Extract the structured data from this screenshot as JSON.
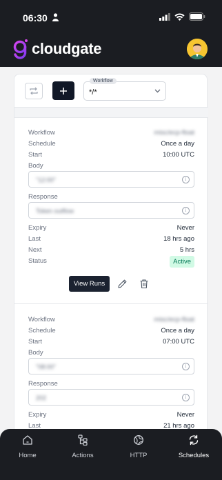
{
  "status_bar": {
    "time": "06:30"
  },
  "header": {
    "app_name": "cloudgate"
  },
  "toolbar": {
    "workflow_legend": "Workflow",
    "workflow_value": "*/*"
  },
  "entries": [
    {
      "workflow_label": "Workflow",
      "workflow_value": "misc/ecp-float",
      "schedule_label": "Schedule",
      "schedule_value": "Once a day",
      "start_label": "Start",
      "start_value": "10:00 UTC",
      "body_label": "Body",
      "body_value": "\"12:00\"",
      "response_label": "Response",
      "response_value": "Token outflow",
      "expiry_label": "Expiry",
      "expiry_value": "Never",
      "last_label": "Last",
      "last_value": "18 hrs ago",
      "next_label": "Next",
      "next_value": "5 hrs",
      "status_label": "Status",
      "status_value": "Active",
      "view_runs_label": "View Runs"
    },
    {
      "workflow_label": "Workflow",
      "workflow_value": "misc/ecp-float",
      "schedule_label": "Schedule",
      "schedule_value": "Once a day",
      "start_label": "Start",
      "start_value": "07:00 UTC",
      "body_label": "Body",
      "body_value": "\"08:00\"",
      "response_label": "Response",
      "response_value": "202",
      "expiry_label": "Expiry",
      "expiry_value": "Never",
      "last_label": "Last",
      "last_value": "21 hrs ago"
    }
  ],
  "bottom_nav": [
    {
      "label": "Home",
      "icon": "home-icon"
    },
    {
      "label": "Actions",
      "icon": "hierarchy-icon"
    },
    {
      "label": "HTTP",
      "icon": "globe-icon"
    },
    {
      "label": "Schedules",
      "icon": "refresh-icon",
      "active": true
    }
  ],
  "colors": {
    "dark": "#1b1d22",
    "accent_active": "#047857",
    "active_bg": "#d1fae5",
    "logo_gradient_start": "#d946ef",
    "logo_gradient_end": "#7c3aed"
  }
}
